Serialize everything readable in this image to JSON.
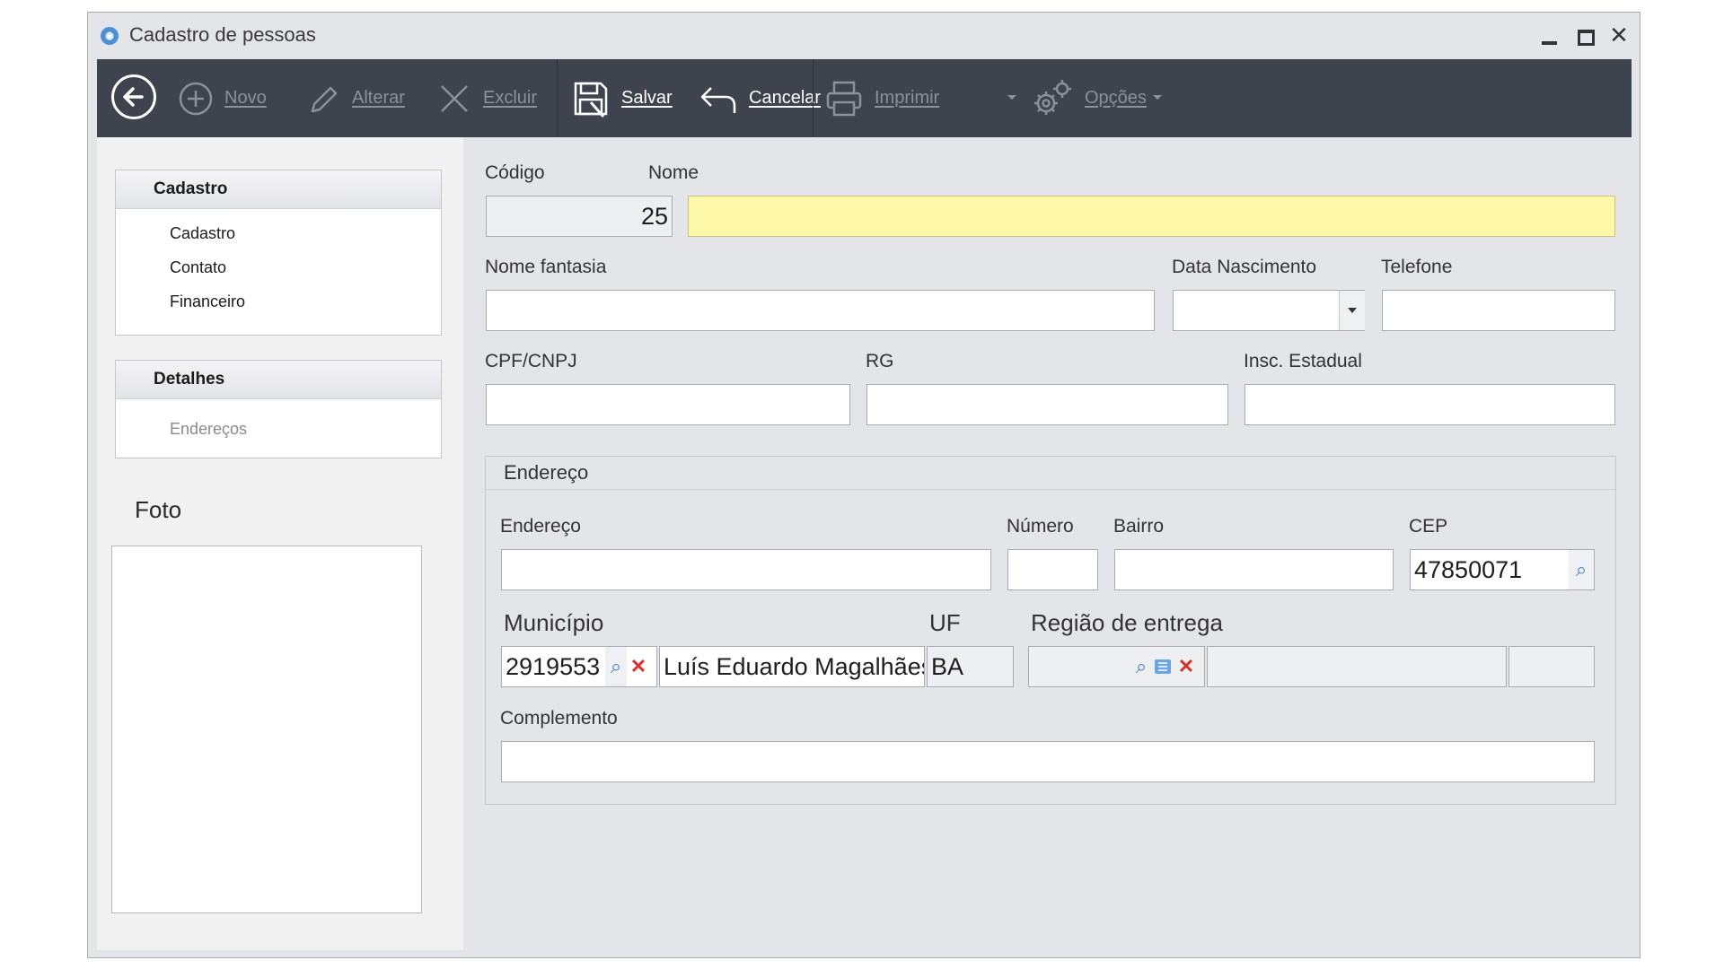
{
  "window": {
    "title": "Cadastro de pessoas"
  },
  "toolbar": {
    "novo": "Novo",
    "alterar": "Alterar",
    "excluir": "Excluir",
    "salvar": "Salvar",
    "cancelar": "Cancelar",
    "imprimir": "Imprimir",
    "opcoes": "Opções"
  },
  "nav": {
    "cadastro_header": "Cadastro",
    "cadastro_items": [
      "Cadastro",
      "Contato",
      "Financeiro"
    ],
    "detalhes_header": "Detalhes",
    "detalhes_items": [
      "Endereços"
    ]
  },
  "foto": {
    "label": "Foto"
  },
  "form": {
    "codigo_label": "Código",
    "codigo_value": "25",
    "nome_label": "Nome",
    "nome_value": "",
    "nome_fantasia_label": "Nome fantasia",
    "data_nascimento_label": "Data Nascimento",
    "telefone_label": "Telefone",
    "cpf_label": "CPF/CNPJ",
    "rg_label": "RG",
    "insc_label": "Insc. Estadual"
  },
  "endereco": {
    "group_title": "Endereço",
    "endereco_label": "Endereço",
    "numero_label": "Número",
    "bairro_label": "Bairro",
    "cep_label": "CEP",
    "cep_value": "47850071",
    "municipio_label": "Município",
    "municipio_code": "2919553",
    "municipio_name": "Luís Eduardo Magalhães",
    "uf_label": "UF",
    "uf_value": "BA",
    "regiao_label": "Região de entrega",
    "complemento_label": "Complemento"
  },
  "colors": {
    "toolbar_bg": "#3f434d",
    "required_field": "#fdf7a8",
    "window_bg": "#e4e5e9"
  }
}
